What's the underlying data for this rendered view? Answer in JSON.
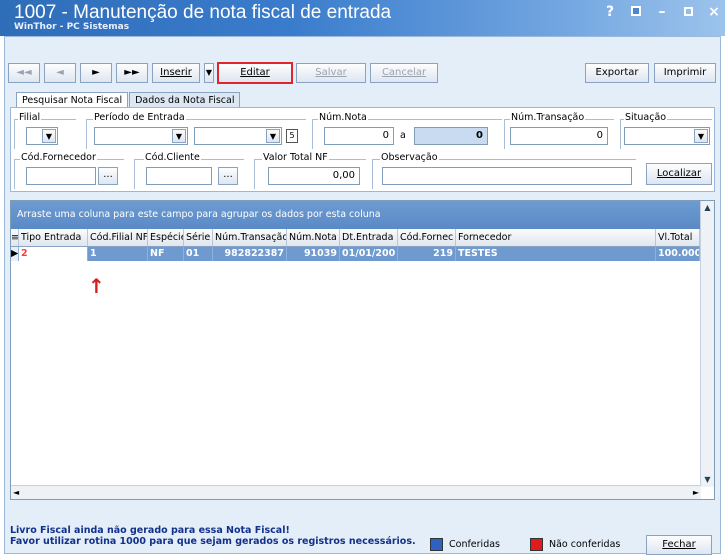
{
  "window": {
    "title": "1007 - Manutenção de nota fiscal de entrada",
    "subtitle": "WinThor - PC Sistemas",
    "controls": [
      "?",
      "restore",
      "minimize",
      "maximize",
      "close"
    ]
  },
  "toolbar": {
    "first": "◄◄",
    "prev": "◄",
    "next": "►",
    "last": "►►",
    "inserir": "Inserir",
    "editar": "Editar",
    "salvar": "Salvar",
    "cancelar": "Cancelar",
    "exportar": "Exportar",
    "imprimir": "Imprimir"
  },
  "tabs": [
    {
      "label": "Pesquisar Nota Fiscal",
      "active": true
    },
    {
      "label": "Dados da Nota Fiscal",
      "active": false
    }
  ],
  "filters": {
    "filial_label": "Filial",
    "periodo_label": "Período de Entrada",
    "num_nota_label": "Núm.Nota",
    "num_nota_from": "0",
    "num_nota_sep": "a",
    "num_nota_to": "0",
    "num_transacao_label": "Núm.Transação",
    "num_transacao": "0",
    "situacao_label": "Situação",
    "cod_fornecedor_label": "Cód.Fornecedor",
    "cod_cliente_label": "Cód.Cliente",
    "valor_total_label": "Valor Total NF",
    "valor_total": "0,00",
    "observacao_label": "Observação",
    "browse": "...",
    "localizar": "Localizar"
  },
  "grid": {
    "group_hint": "Arraste uma coluna para este campo para agrupar os dados por esta coluna",
    "columns": [
      "Tipo Entrada",
      "Cód.Filial NF",
      "Espécie",
      "Série",
      "Núm.Transação",
      "Núm.Nota",
      "Dt.Entrada",
      "Cód.Fornec",
      "Fornecedor",
      "Vl.Total"
    ],
    "rows": [
      [
        "2",
        "1",
        "NF",
        "01",
        "982822387",
        "91039",
        "01/01/200",
        "219",
        "TESTES",
        "100.000,0"
      ]
    ]
  },
  "status": {
    "line1": "Livro Fiscal ainda não gerado para essa Nota Fiscal!",
    "line2": "Favor utilizar rotina 1000 para que sejam gerados os registros necessários."
  },
  "legend": {
    "conferidas": "Conferidas",
    "conferidas_color": "#2f62c0",
    "nao_conferidas": "Não conferidas",
    "nao_conferidas_color": "#e01b1b",
    "fechar": "Fechar"
  }
}
